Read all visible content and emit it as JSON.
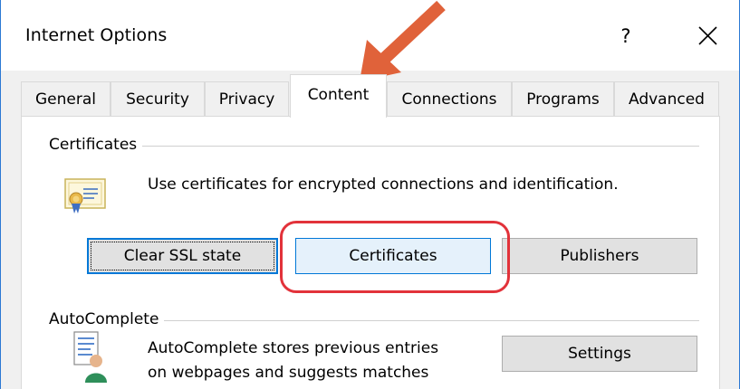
{
  "window": {
    "title": "Internet Options",
    "help_glyph": "?",
    "close_glyph": "✕"
  },
  "tabs": [
    {
      "label": "General"
    },
    {
      "label": "Security"
    },
    {
      "label": "Privacy"
    },
    {
      "label": "Content",
      "selected": true
    },
    {
      "label": "Connections"
    },
    {
      "label": "Programs"
    },
    {
      "label": "Advanced"
    }
  ],
  "certificates": {
    "group_label": "Certificates",
    "description": "Use certificates for encrypted connections and identification.",
    "buttons": {
      "clear_ssl": "Clear SSL state",
      "certificates": "Certificates",
      "publishers": "Publishers"
    }
  },
  "autocomplete": {
    "group_label": "AutoComplete",
    "description_line1": "AutoComplete stores previous entries",
    "description_line2": "on webpages and suggests matches",
    "settings_button": "Settings"
  },
  "annotations": {
    "arrow_color": "#e0623a",
    "highlight_color": "#e2323a"
  },
  "colors": {
    "focus_border": "#0078d7",
    "window_border": "#2b79d4"
  }
}
